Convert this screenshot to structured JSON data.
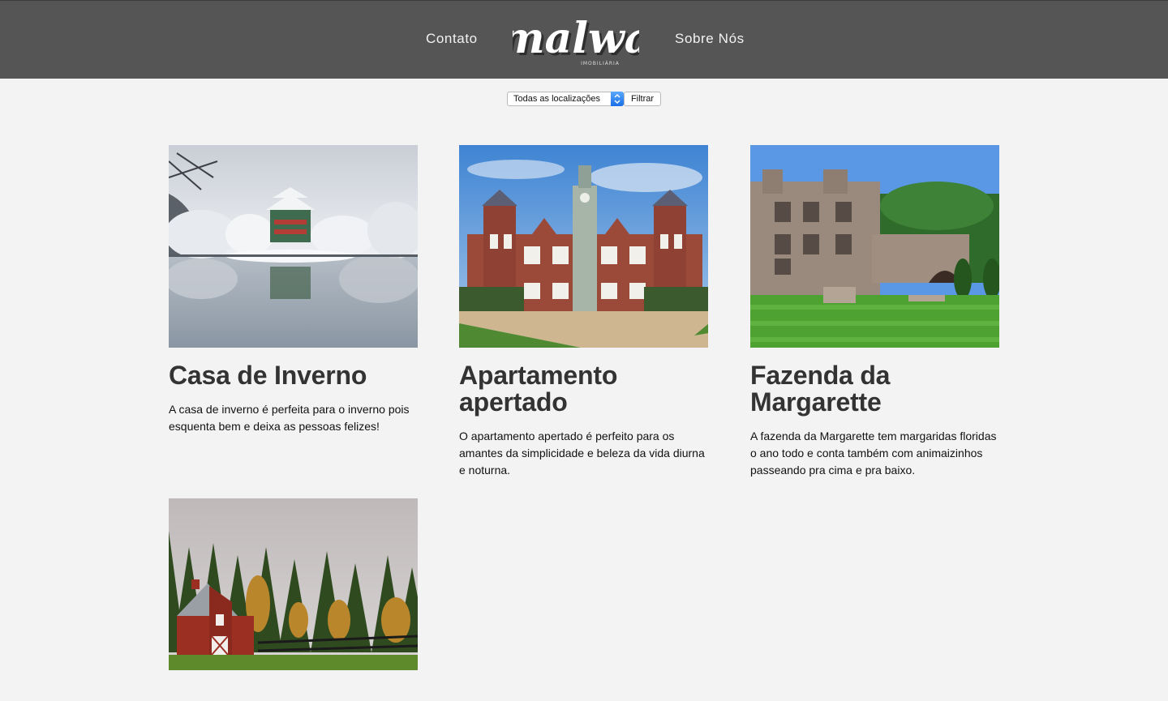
{
  "header": {
    "nav_left": "Contato",
    "nav_right": "Sobre Nós",
    "logo_text": "malwa",
    "logo_subtext": "IMOBILIÁRIA",
    "background": "#555555"
  },
  "filter": {
    "select_value": "Todas as localizações",
    "button_label": "Filtrar"
  },
  "listings": [
    {
      "title": "Casa de Inverno",
      "description": "A casa de inverno é perfeita para o inverno pois esquenta bem e deixa as pessoas felizes!",
      "image": "winter-pagoda-lake-photo"
    },
    {
      "title": "Apartamento apertado",
      "description": "O apartamento apertado é perfeito para os amantes da simplicidade e beleza da vida diurna e noturna.",
      "image": "brick-manor-house-photo"
    },
    {
      "title": "Fazenda da Margarette",
      "description": "A fazenda da Margarette tem margaridas floridas o ano todo e conta também com animaizinhos passeando pra cima e pra baixo.",
      "image": "stone-castle-lawn-photo"
    },
    {
      "title": "",
      "description": "",
      "image": "red-barn-autumn-forest-photo"
    }
  ]
}
